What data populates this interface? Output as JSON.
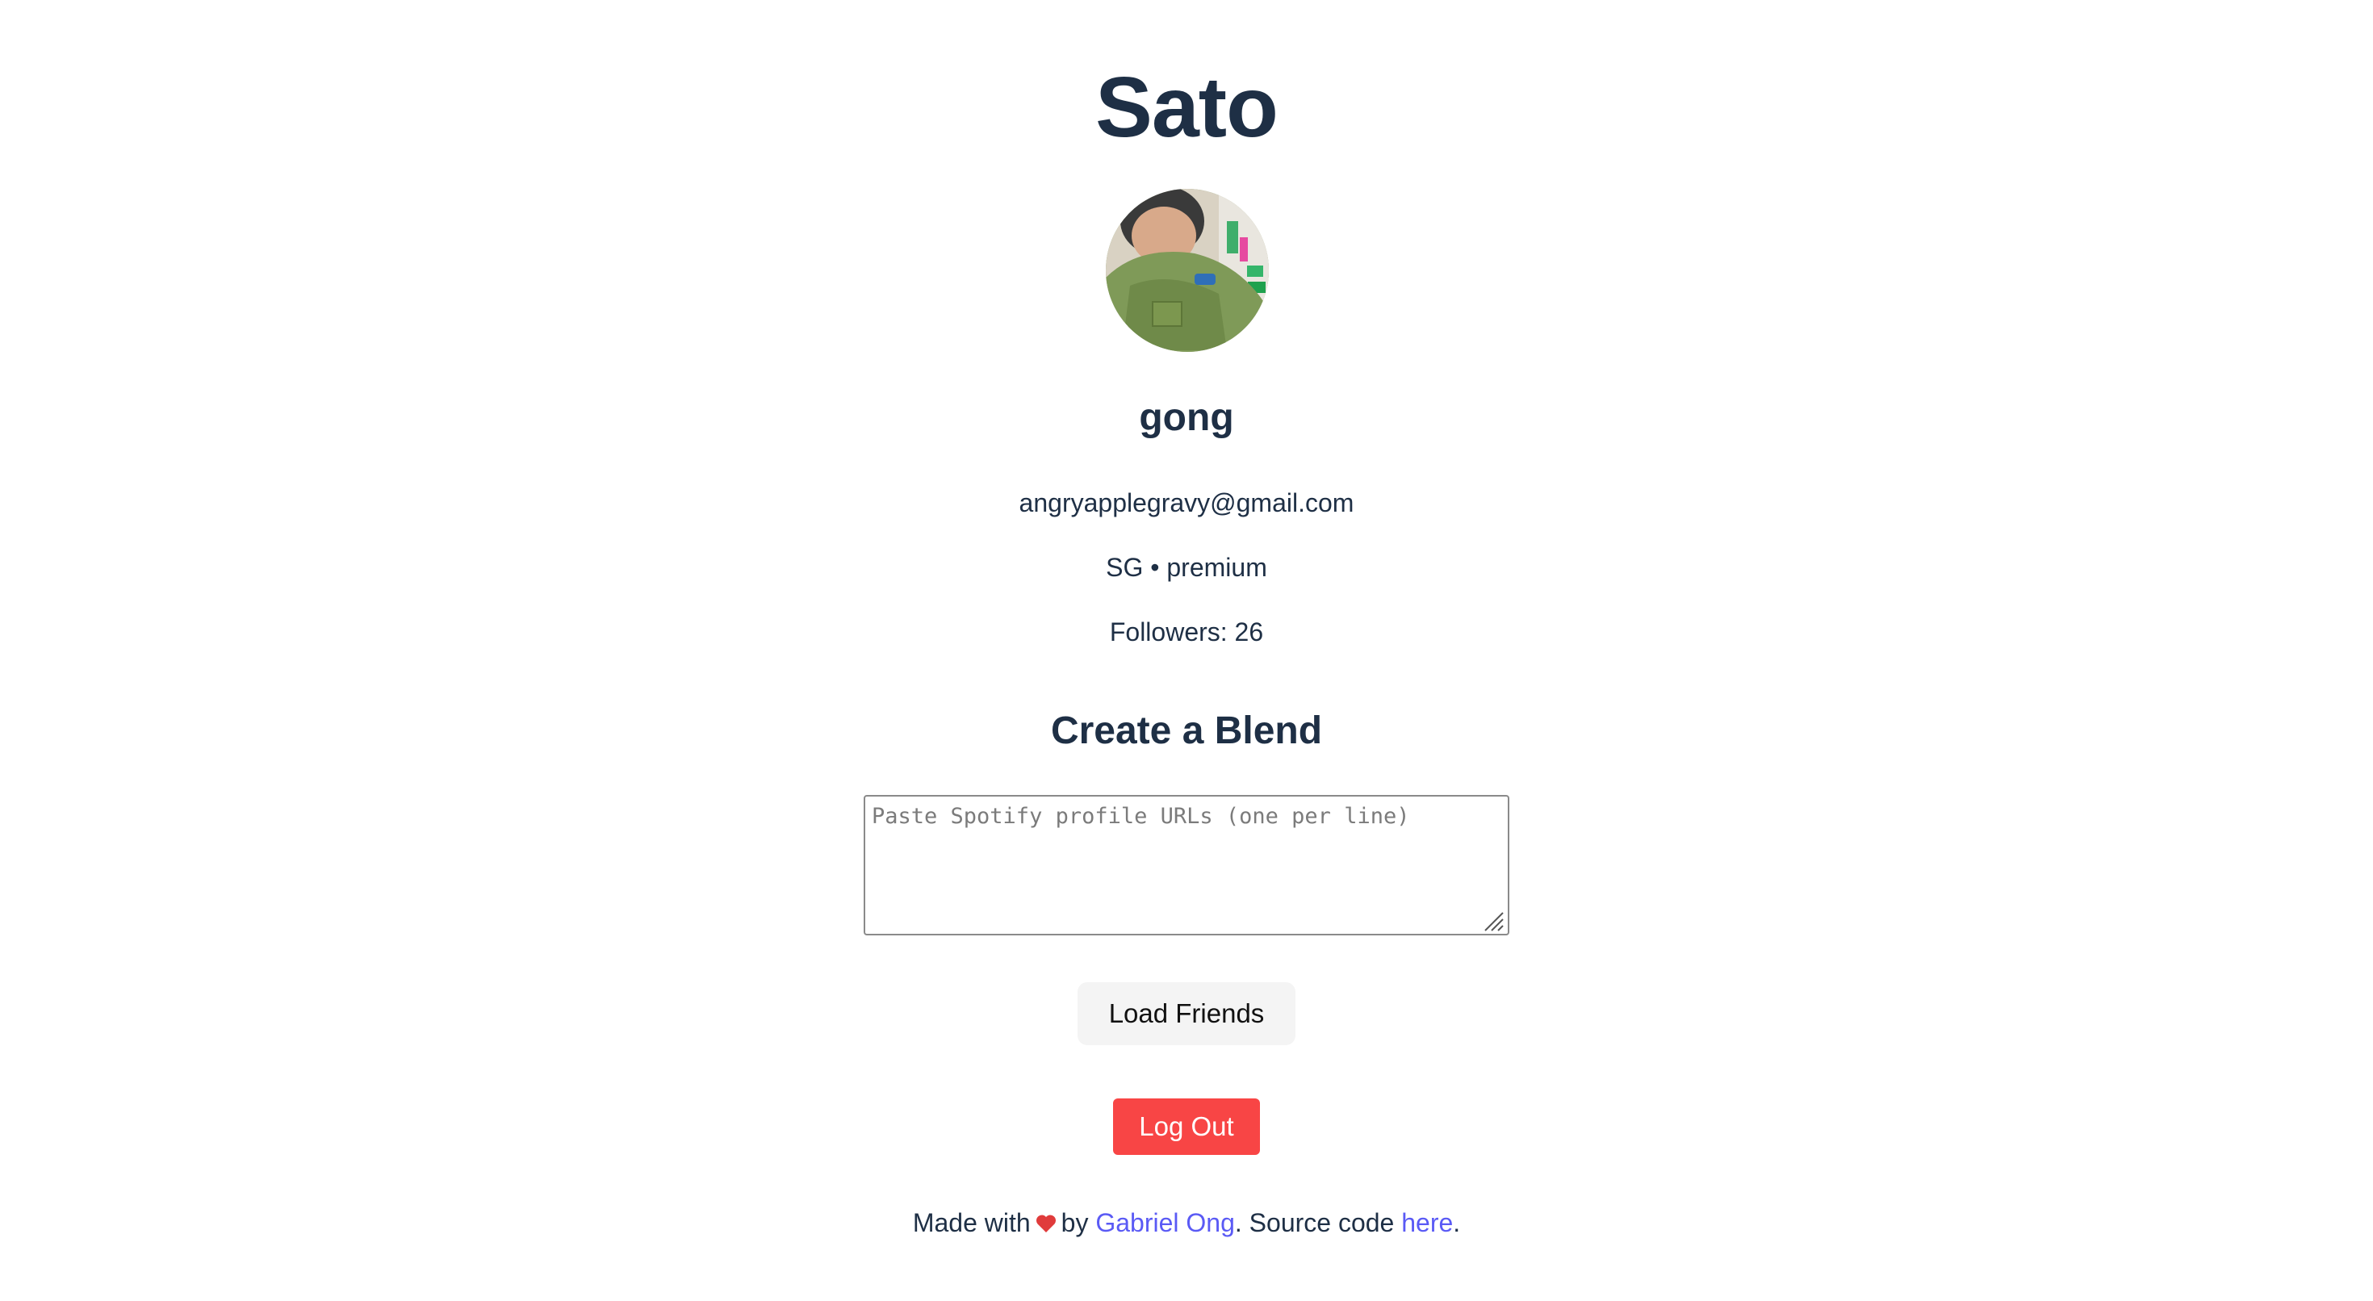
{
  "header": {
    "app_title": "Sato"
  },
  "profile": {
    "avatar_icon": "user-photo",
    "display_name": "gong",
    "email": "angryapplegravy@gmail.com",
    "country": "SG",
    "separator": "•",
    "product": "premium",
    "followers_label": "Followers:",
    "followers_count": "26"
  },
  "blend": {
    "heading": "Create a Blend",
    "urls_value": "",
    "urls_placeholder": "Paste Spotify profile URLs (one per line)",
    "load_button_label": "Load Friends"
  },
  "session": {
    "logout_button_label": "Log Out",
    "logout_color": "#f84545"
  },
  "footer": {
    "made_with": "Made with",
    "heart_icon": "heart-icon",
    "heart_color": "#e03b3b",
    "by": "by",
    "author_link": "Gabriel Ong",
    "source_text": ". Source code",
    "source_link": "here",
    "end": ".",
    "link_color": "#5a5af5"
  }
}
